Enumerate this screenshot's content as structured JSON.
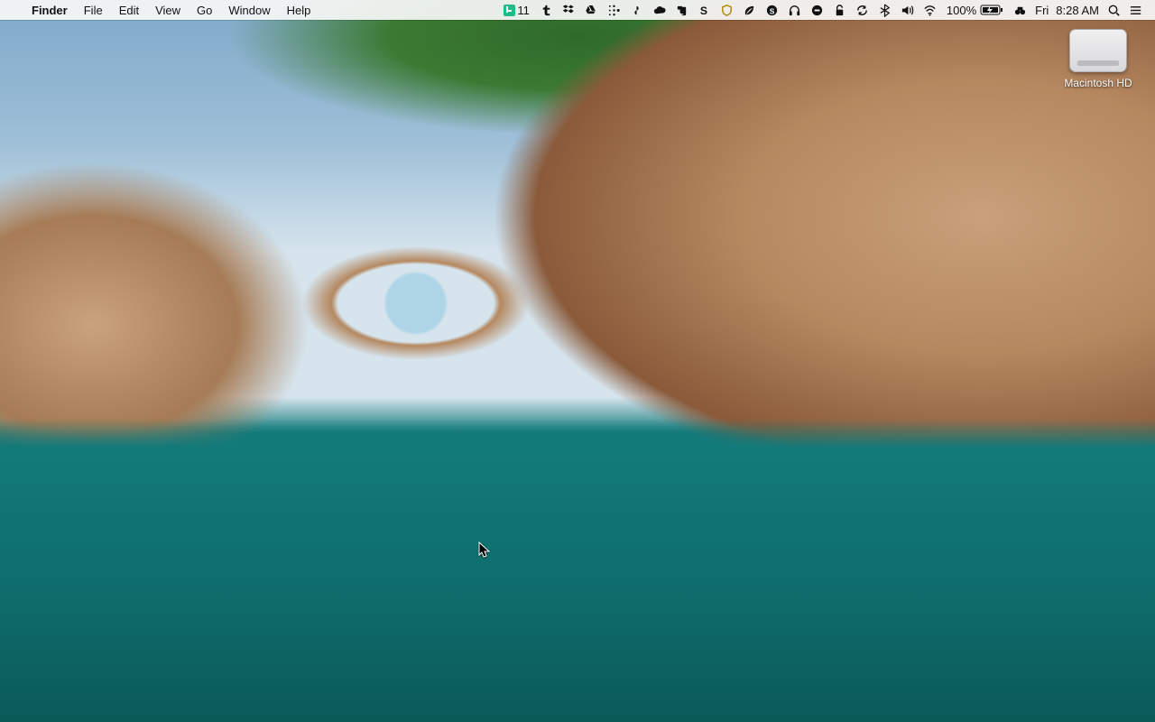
{
  "menubar": {
    "apple": "",
    "app": "Finder",
    "items": [
      "File",
      "Edit",
      "View",
      "Go",
      "Window",
      "Help"
    ]
  },
  "status": {
    "todoist_count": "11",
    "battery_pct": "100%",
    "day": "Fri",
    "time": "8:28 AM",
    "icons": [
      "todoist-icon",
      "tumblr-icon",
      "dropbox-icon",
      "googledrive-icon",
      "fitbit-icon",
      "fan-icon",
      "cloud-icon",
      "evernote-icon",
      "sublime-icon",
      "shield-icon",
      "leaf-icon",
      "skype-icon",
      "headphones-icon",
      "dash-icon",
      "lock-icon",
      "sync-icon",
      "bluetooth-icon",
      "volume-icon",
      "wifi-icon",
      "battery-icon",
      "binoculars-icon"
    ]
  },
  "desktop": {
    "hd_label": "Macintosh HD"
  }
}
